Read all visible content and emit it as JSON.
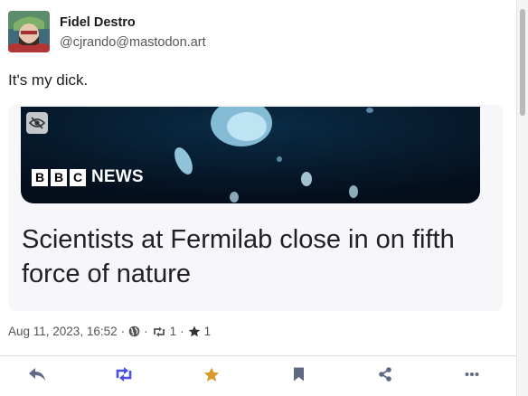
{
  "post": {
    "author": {
      "display_name": "Fidel Destro",
      "handle": "@cjrando@mastodon.art"
    },
    "text": "It's my dick.",
    "card": {
      "source_logo_letters": [
        "B",
        "B",
        "C"
      ],
      "source_logo_word": "NEWS",
      "title": "Scientists at Fermilab close in on fifth force of nature"
    },
    "meta": {
      "timestamp": "Aug 11, 2023, 16:52",
      "separator": "·",
      "boost_count": "1",
      "favourite_count": "1",
      "visibility_icon": "globe-icon",
      "boost_icon": "boost-icon",
      "favourite_icon": "star-icon"
    },
    "actions": [
      {
        "name": "reply-button",
        "icon": "reply-icon"
      },
      {
        "name": "boost-button",
        "icon": "boost-icon"
      },
      {
        "name": "favourite-button",
        "icon": "star-icon"
      },
      {
        "name": "bookmark-button",
        "icon": "bookmark-icon"
      },
      {
        "name": "share-button",
        "icon": "share-icon"
      },
      {
        "name": "more-button",
        "icon": "ellipsis-icon"
      }
    ]
  },
  "colors": {
    "boost_active": "#4a4ee2",
    "favourite_active": "#d99a2a",
    "icon_default": "#606984"
  }
}
